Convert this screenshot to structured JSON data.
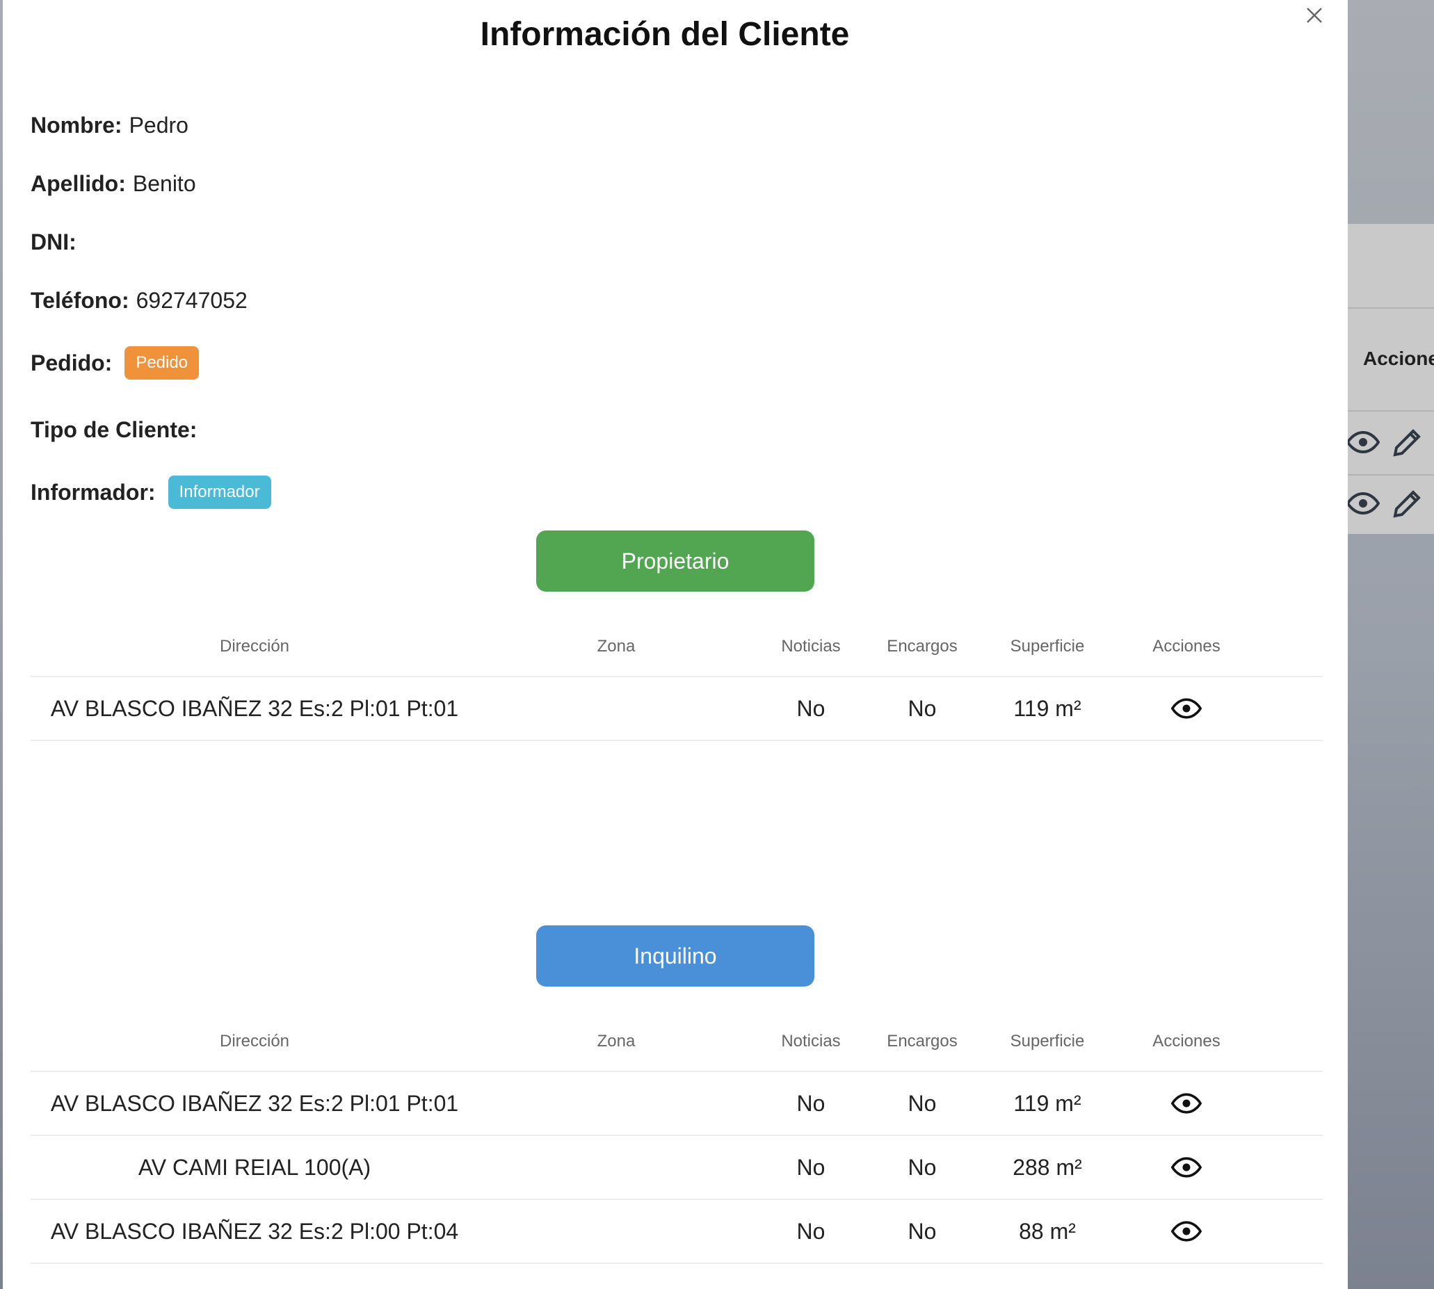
{
  "background": {
    "column_header": "Accione"
  },
  "modal": {
    "title": "Información del Cliente",
    "fields": {
      "nombre": {
        "label": "Nombre:",
        "value": "Pedro"
      },
      "apellido": {
        "label": "Apellido:",
        "value": "Benito"
      },
      "dni": {
        "label": "DNI:",
        "value": ""
      },
      "telefono": {
        "label": "Teléfono:",
        "value": "692747052"
      },
      "pedido": {
        "label": "Pedido:",
        "badge": "Pedido",
        "badge_color": "#f0923a"
      },
      "tipo": {
        "label": "Tipo de Cliente:",
        "value": ""
      },
      "informador": {
        "label": "Informador:",
        "badge": "Informador",
        "badge_color": "#4bbad6"
      }
    },
    "propietario": {
      "button_label": "Propietario",
      "button_color": "#52a651",
      "columns": [
        "Dirección",
        "Zona",
        "Noticias",
        "Encargos",
        "Superficie",
        "Acciones"
      ],
      "rows": [
        {
          "direccion": "AV BLASCO IBAÑEZ 32 Es:2 Pl:01 Pt:01",
          "zona": "",
          "noticias": "No",
          "encargos": "No",
          "superficie": "119 m²"
        }
      ]
    },
    "inquilino": {
      "button_label": "Inquilino",
      "button_color": "#4a90d9",
      "columns": [
        "Dirección",
        "Zona",
        "Noticias",
        "Encargos",
        "Superficie",
        "Acciones"
      ],
      "rows": [
        {
          "direccion": "AV BLASCO IBAÑEZ 32 Es:2 Pl:01 Pt:01",
          "zona": "",
          "noticias": "No",
          "encargos": "No",
          "superficie": "119 m²"
        },
        {
          "direccion": "AV CAMI REIAL 100(A)",
          "zona": "",
          "noticias": "No",
          "encargos": "No",
          "superficie": "288 m²"
        },
        {
          "direccion": "AV BLASCO IBAÑEZ 32 Es:2 Pl:00 Pt:04",
          "zona": "",
          "noticias": "No",
          "encargos": "No",
          "superficie": "88 m²"
        }
      ]
    }
  }
}
